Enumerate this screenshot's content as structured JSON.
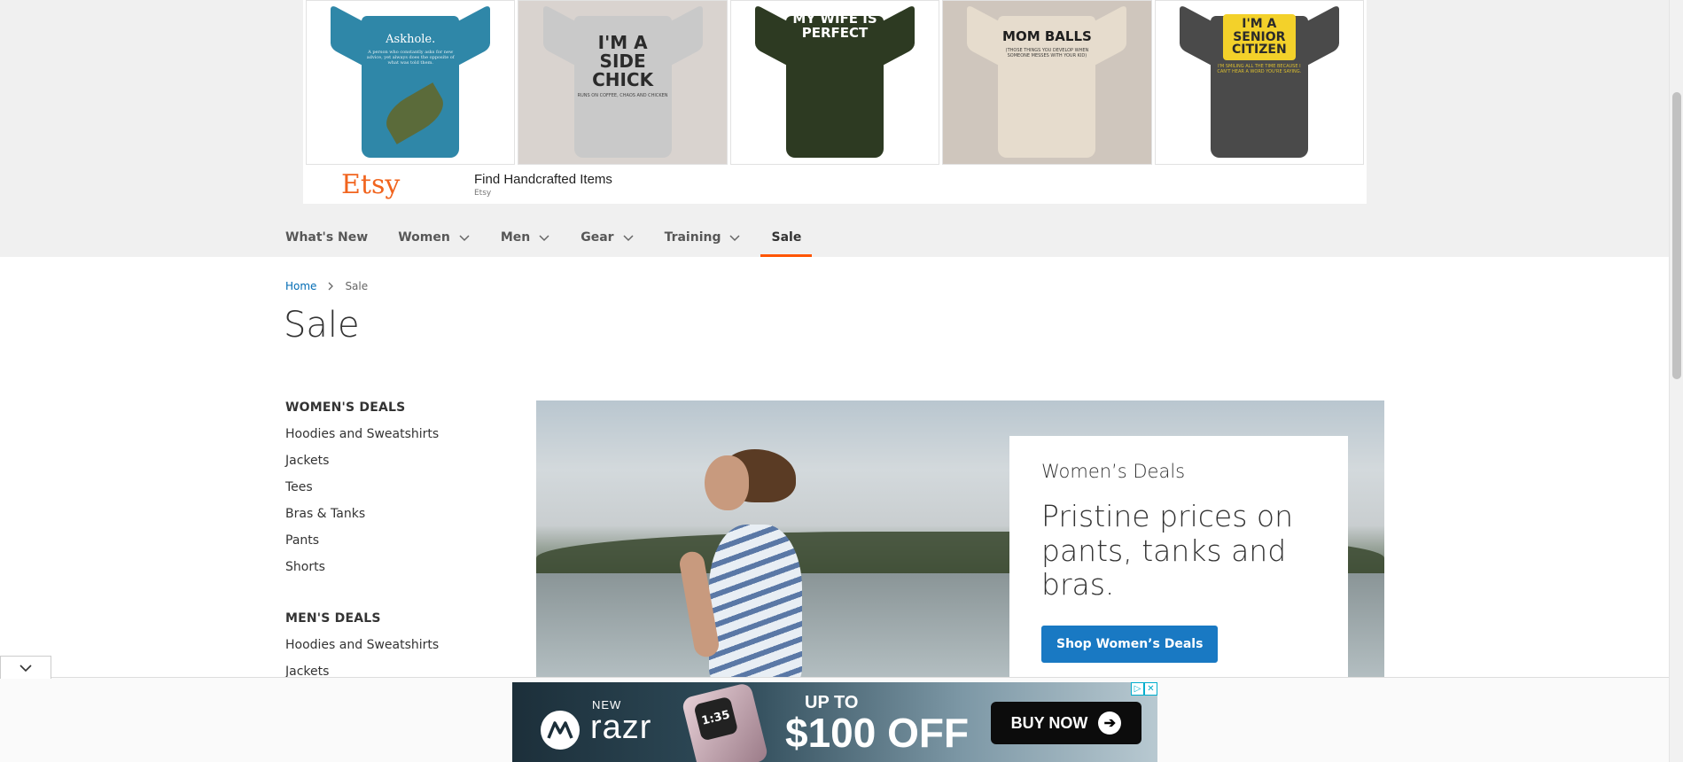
{
  "etsy_ad": {
    "shirts": [
      {
        "text": "Askhole.",
        "sub": "A person who constantly asks for new advice, yet always does the opposite of what was told them.",
        "color": "#2f87a8",
        "ink": "#ffffff"
      },
      {
        "text": "I'M A SIDE CHICK",
        "sub": "RUNS ON COFFEE, CHAOS AND CHICKEN",
        "color": "#c9c9c9",
        "ink": "#2b2b2b"
      },
      {
        "text": "MY WIFE IS PERFECT",
        "sub": "",
        "color": "#2d3a22",
        "ink": "#ffffff"
      },
      {
        "text": "MOM BALLS",
        "sub": "(THOSE THINGS YOU DEVELOP WHEN SOMEONE MESSES WITH YOUR KID)",
        "color": "#e6dccd",
        "ink": "#1e1e1e"
      },
      {
        "text": "I'M A SENIOR CITIZEN",
        "sub": "I'M SMILING ALL THE TIME BECAUSE I CAN'T HEAR A WORD YOU'RE SAYING.",
        "color": "#4a4a4a",
        "ink": "#f3d12a"
      }
    ],
    "logo": "Etsy",
    "title": "Find Handcrafted Items",
    "subtitle": "Etsy"
  },
  "nav": {
    "items": [
      {
        "label": "What's New",
        "dropdown": false
      },
      {
        "label": "Women",
        "dropdown": true
      },
      {
        "label": "Men",
        "dropdown": true
      },
      {
        "label": "Gear",
        "dropdown": true
      },
      {
        "label": "Training",
        "dropdown": true
      },
      {
        "label": "Sale",
        "dropdown": false,
        "active": true
      }
    ]
  },
  "breadcrumb": {
    "home": "Home",
    "current": "Sale"
  },
  "page": {
    "title": "Sale"
  },
  "sidebar": {
    "womens": {
      "heading": "WOMEN'S DEALS",
      "items": [
        "Hoodies and Sweatshirts",
        "Jackets",
        "Tees",
        "Bras & Tanks",
        "Pants",
        "Shorts"
      ]
    },
    "mens": {
      "heading": "MEN'S DEALS",
      "items": [
        "Hoodies and Sweatshirts",
        "Jackets"
      ]
    }
  },
  "hero": {
    "kicker": "Women’s Deals",
    "headline": "Pristine prices on pants, tanks and bras.",
    "button": "Shop Women’s Deals"
  },
  "razr_ad": {
    "new": "NEW",
    "brand": "razr",
    "phone_screen": "1:35",
    "up_to": "UP TO",
    "offer": "$100 OFF",
    "cta": "BUY NOW"
  },
  "colors": {
    "accent": "#ff5501",
    "link": "#006bb4",
    "button": "#1979c3",
    "etsy": "#f1641e"
  }
}
